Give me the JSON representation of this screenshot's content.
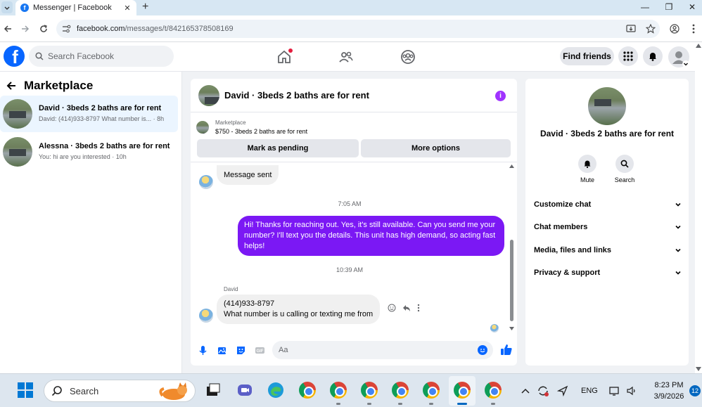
{
  "browser": {
    "tab_title": "Messenger | Facebook",
    "url_host": "facebook.com",
    "url_path": "/messages/t/842165378508169"
  },
  "header": {
    "search_placeholder": "Search Facebook",
    "find_friends": "Find friends"
  },
  "left_panel": {
    "title": "Marketplace",
    "conversations": [
      {
        "name": "David · 3beds 2 baths are for rent",
        "preview": "David: (414)933-8797 What number is... · 8h"
      },
      {
        "name": "Alessna · 3beds 2 baths are for rent",
        "preview": "You: hi are you interested · 10h"
      }
    ]
  },
  "chat": {
    "title": "David · 3beds 2 baths are for rent",
    "marketplace_label": "Marketplace",
    "listing": "$750 - 3beds 2 baths are for rent",
    "mark_pending": "Mark as pending",
    "more_options": "More options",
    "message_sent": "Message sent",
    "time1": "7:05 AM",
    "outgoing": "Hi! Thanks for reaching out. Yes, it's still available. Can you send me your number? I'll text you the details. This unit has high demand, so acting fast helps!",
    "time2": "10:39 AM",
    "sender": "David",
    "incoming_line1": "(414)933-8797",
    "incoming_line2": "What number is u calling or texting me from",
    "composer_placeholder": "Aa"
  },
  "right_panel": {
    "name": "David · 3beds 2 baths are for rent",
    "mute": "Mute",
    "search": "Search",
    "sections": [
      "Customize chat",
      "Chat members",
      "Media, files and links",
      "Privacy & support"
    ]
  },
  "taskbar": {
    "search": "Search",
    "lang": "ENG",
    "time": "8:23 PM",
    "date": "3/9/2026",
    "notif_count": "12"
  },
  "colors": {
    "facebook_blue": "#0866ff",
    "messenger_purple": "#7b18f4",
    "active_row": "#ebf5ff"
  }
}
